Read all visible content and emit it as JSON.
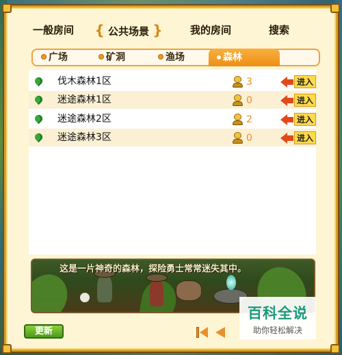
{
  "top_tabs": [
    {
      "label": "一般房间"
    },
    {
      "label": "公共场景",
      "bracket_left": "{",
      "bracket_right": "}"
    },
    {
      "label": "我的房间"
    },
    {
      "label": "搜索"
    }
  ],
  "sub_tabs": [
    {
      "label": "广场"
    },
    {
      "label": "矿洞"
    },
    {
      "label": "渔场"
    },
    {
      "label": "森林",
      "selected": true
    }
  ],
  "rooms": [
    {
      "name": "伐木森林1区",
      "count": "3",
      "enter_label": "进入"
    },
    {
      "name": "迷途森林1区",
      "count": "0",
      "enter_label": "进入"
    },
    {
      "name": "迷途森林2区",
      "count": "2",
      "enter_label": "进入"
    },
    {
      "name": "迷途森林3区",
      "count": "0",
      "enter_label": "进入"
    }
  ],
  "banner": {
    "caption": "这是一片神奇的森林，探险勇士常常迷失其中。"
  },
  "controls": {
    "refresh_label": "更新"
  },
  "watermark": {
    "title": "百科全说",
    "subtitle": "助你轻松解决"
  },
  "colors": {
    "accent": "#ee8e14",
    "frame": "#d6a02a",
    "count": "#e8902a",
    "refresh": "#4e9a1c"
  },
  "icons": {
    "room_status": "green-leaf-icon",
    "people": "person-icon",
    "enter": "arrow-left-icon",
    "first_page": "first-page-icon",
    "prev_page": "prev-page-icon"
  }
}
